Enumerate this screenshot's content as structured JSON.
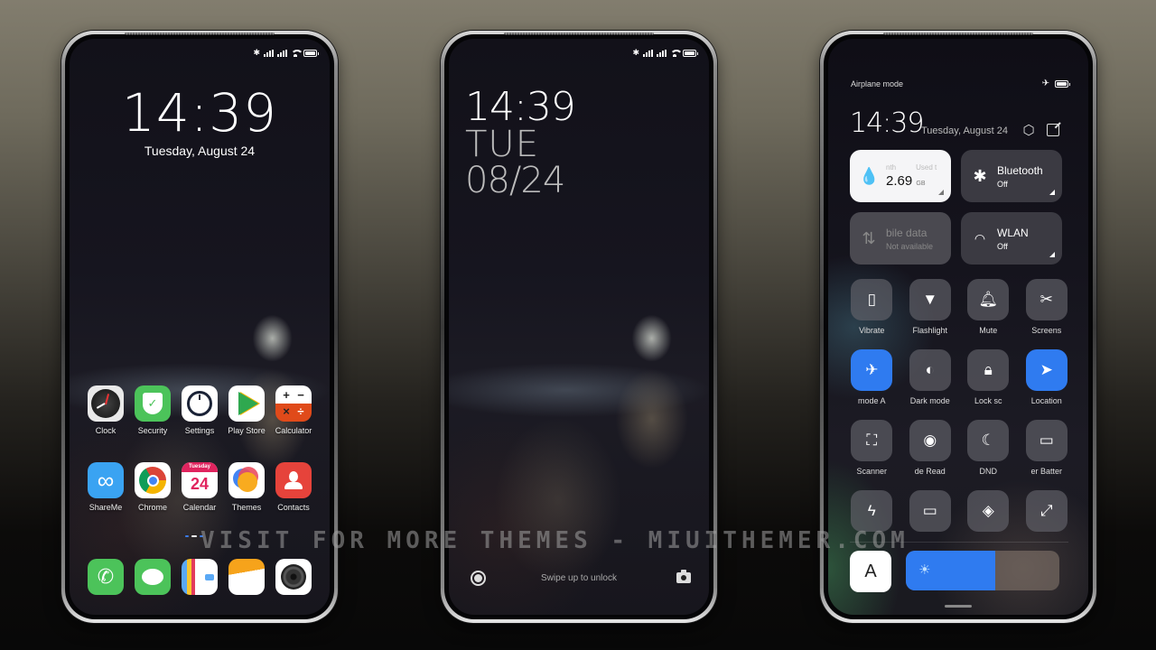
{
  "status_bar": {
    "icons": [
      "bluetooth-icon",
      "signal-icon",
      "signal-icon",
      "wifi-icon",
      "battery-icon"
    ]
  },
  "home_screen": {
    "time": "14:39",
    "date": "Tuesday, August 24",
    "apps_row1": [
      {
        "label": "Clock",
        "icon": "clock-icon"
      },
      {
        "label": "Security",
        "icon": "shield-icon"
      },
      {
        "label": "Settings",
        "icon": "settings-icon"
      },
      {
        "label": "Play Store",
        "icon": "play-store-icon"
      },
      {
        "label": "Calculator",
        "icon": "calculator-icon"
      }
    ],
    "apps_row2": [
      {
        "label": "ShareMe",
        "icon": "shareme-icon"
      },
      {
        "label": "Chrome",
        "icon": "chrome-icon"
      },
      {
        "label": "Calendar",
        "icon": "calendar-icon",
        "day_name": "Tuesday",
        "day_number": "24"
      },
      {
        "label": "Themes",
        "icon": "themes-icon"
      },
      {
        "label": "Contacts",
        "icon": "contacts-icon"
      }
    ],
    "dock": [
      {
        "name": "phone",
        "icon": "phone-icon"
      },
      {
        "name": "messages",
        "icon": "message-icon"
      },
      {
        "name": "notes",
        "icon": "notes-icon"
      },
      {
        "name": "gallery",
        "icon": "gallery-icon"
      },
      {
        "name": "camera",
        "icon": "camera-icon"
      }
    ]
  },
  "lock_screen": {
    "time": "14:39",
    "day": "TUE",
    "month_day": "08/24",
    "swipe_text": "Swipe up to unlock"
  },
  "control_center": {
    "airplane_label": "Airplane mode",
    "time": "14:39",
    "date": "Tuesday, August 24",
    "data_tile": {
      "label_left": "nth",
      "label_right": "Used t",
      "value": "2.69",
      "unit": "GB"
    },
    "bluetooth_tile": {
      "title": "Bluetooth",
      "status": "Off"
    },
    "mobile_tile": {
      "title": "bile data",
      "status": "Not available"
    },
    "wlan_tile": {
      "title": "WLAN",
      "status": "Off"
    },
    "toggles": [
      {
        "label": "Vibrate",
        "icon": "vibrate-icon",
        "on": false
      },
      {
        "label": "Flashlight",
        "icon": "flashlight-icon",
        "on": false
      },
      {
        "label": "Mute",
        "icon": "bell-icon",
        "on": false
      },
      {
        "label": "Screens",
        "icon": "screenshot-icon",
        "on": false
      },
      {
        "label": "mode     A",
        "icon": "airplane-icon",
        "on": true
      },
      {
        "label": "Dark mode",
        "icon": "dark-mode-icon",
        "on": false
      },
      {
        "label": "Lock sc",
        "icon": "lock-icon",
        "on": false
      },
      {
        "label": "Location",
        "icon": "location-icon",
        "on": true
      },
      {
        "label": "Scanner",
        "icon": "scanner-icon",
        "on": false
      },
      {
        "label": "de     Read",
        "icon": "eye-icon",
        "on": false
      },
      {
        "label": "DND",
        "icon": "moon-icon",
        "on": false
      },
      {
        "label": "er     Batter",
        "icon": "battery-saver-icon",
        "on": false
      },
      {
        "label": "",
        "icon": "lightning-icon",
        "on": false
      },
      {
        "label": "",
        "icon": "cast-icon",
        "on": false
      },
      {
        "label": "",
        "icon": "link-icon",
        "on": false
      },
      {
        "label": "",
        "icon": "expand-icon",
        "on": false
      }
    ],
    "auto_brightness_label": "A",
    "brightness_level": 0.58
  },
  "watermark": "VISIT FOR MORE THEMES - MIUITHEMER.COM"
}
